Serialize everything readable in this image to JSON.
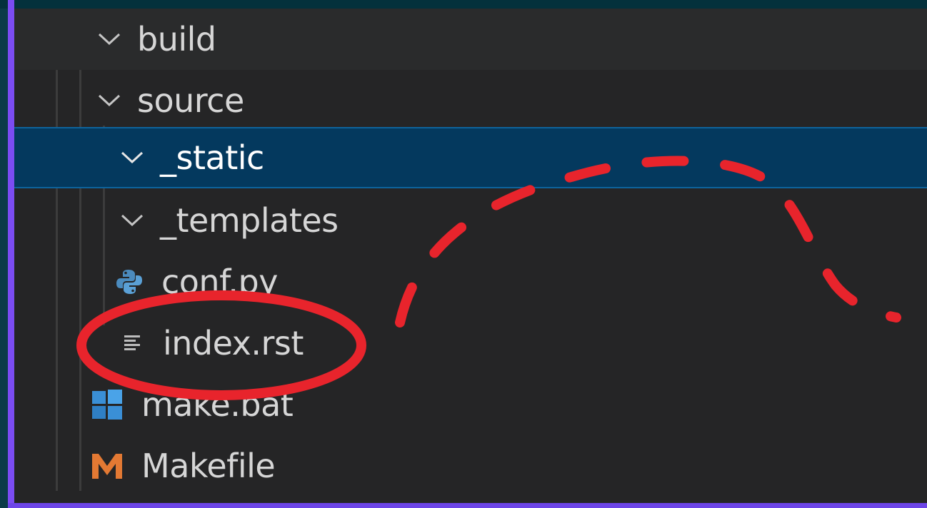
{
  "explorer": {
    "items": [
      {
        "label": "build",
        "type": "folder",
        "icon": "chevron-down-icon"
      },
      {
        "label": "source",
        "type": "folder",
        "icon": "chevron-down-icon"
      },
      {
        "label": "_static",
        "type": "folder",
        "icon": "chevron-down-icon",
        "selected": true
      },
      {
        "label": "_templates",
        "type": "folder",
        "icon": "chevron-down-icon"
      },
      {
        "label": "conf.py",
        "type": "file",
        "icon": "python-file-icon"
      },
      {
        "label": "index.rst",
        "type": "file",
        "icon": "restructuredtext-file-icon"
      },
      {
        "label": "make.bat",
        "type": "file",
        "icon": "windows-batch-icon"
      },
      {
        "label": "Makefile",
        "type": "file",
        "icon": "makefile-icon"
      }
    ]
  },
  "colors": {
    "background": "#252526",
    "selection": "#04395e",
    "selection_border": "#0e639c",
    "accent_left": "#7b4cf2",
    "annotation_red": "#e8242c",
    "python_blue": "#4b8bbe",
    "makefile_orange": "#e37933",
    "windows_blue": "#3a8fd6"
  },
  "annotations": {
    "circle_around": "index.rst",
    "dashed_arc": "red-dashed-arc"
  }
}
